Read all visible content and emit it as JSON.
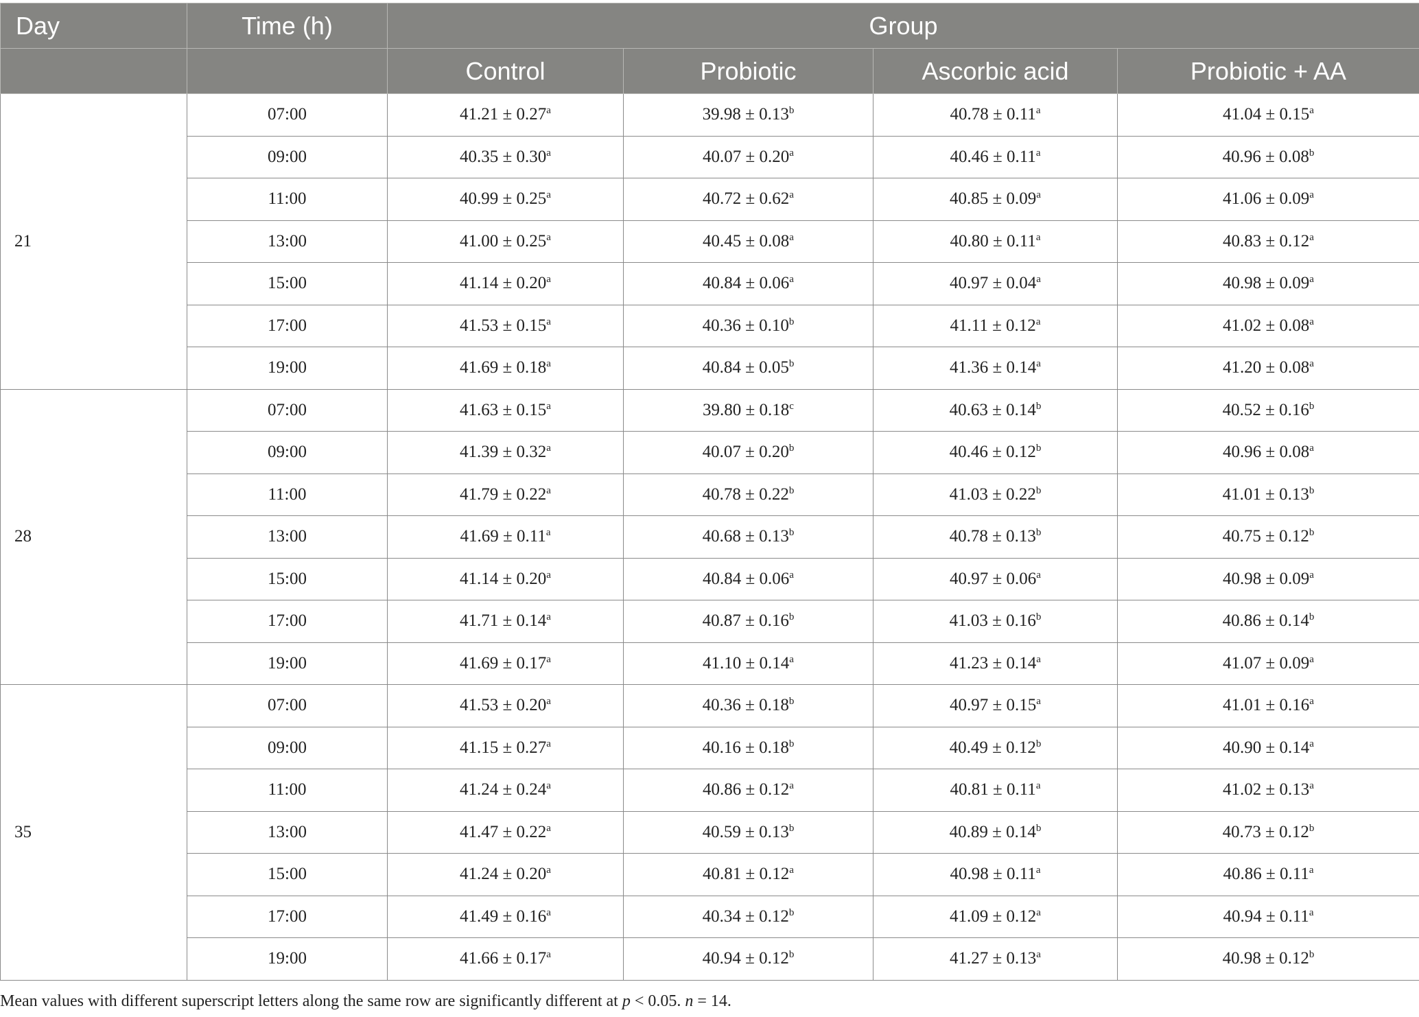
{
  "header": {
    "day": "Day",
    "time": "Time (h)",
    "group": "Group",
    "groups": [
      "Control",
      "Probiotic",
      "Ascorbic acid",
      "Probiotic + AA"
    ]
  },
  "blocks": [
    {
      "day": "21",
      "rows": [
        {
          "time": "07:00",
          "cells": [
            {
              "v": "41.21 ± 0.27",
              "s": "a"
            },
            {
              "v": "39.98 ± 0.13",
              "s": "b"
            },
            {
              "v": "40.78 ± 0.11",
              "s": "a"
            },
            {
              "v": "41.04 ± 0.15",
              "s": "a"
            }
          ]
        },
        {
          "time": "09:00",
          "cells": [
            {
              "v": "40.35 ± 0.30",
              "s": "a"
            },
            {
              "v": "40.07 ± 0.20",
              "s": "a"
            },
            {
              "v": "40.46 ± 0.11",
              "s": "a"
            },
            {
              "v": "40.96 ± 0.08",
              "s": "b"
            }
          ]
        },
        {
          "time": "11:00",
          "cells": [
            {
              "v": "40.99 ± 0.25",
              "s": "a"
            },
            {
              "v": "40.72 ± 0.62",
              "s": "a"
            },
            {
              "v": "40.85 ± 0.09",
              "s": "a"
            },
            {
              "v": "41.06 ± 0.09",
              "s": "a"
            }
          ]
        },
        {
          "time": "13:00",
          "cells": [
            {
              "v": "41.00 ± 0.25",
              "s": "a"
            },
            {
              "v": "40.45 ± 0.08",
              "s": "a"
            },
            {
              "v": "40.80 ± 0.11",
              "s": "a"
            },
            {
              "v": "40.83 ± 0.12",
              "s": "a"
            }
          ]
        },
        {
          "time": "15:00",
          "cells": [
            {
              "v": "41.14 ± 0.20",
              "s": "a"
            },
            {
              "v": "40.84 ± 0.06",
              "s": "a"
            },
            {
              "v": "40.97 ± 0.04",
              "s": "a"
            },
            {
              "v": "40.98 ± 0.09",
              "s": "a"
            }
          ]
        },
        {
          "time": "17:00",
          "cells": [
            {
              "v": "41.53 ± 0.15",
              "s": "a"
            },
            {
              "v": "40.36 ± 0.10",
              "s": "b"
            },
            {
              "v": "41.11 ± 0.12",
              "s": "a"
            },
            {
              "v": "41.02 ± 0.08",
              "s": "a"
            }
          ]
        },
        {
          "time": "19:00",
          "cells": [
            {
              "v": "41.69 ± 0.18",
              "s": "a"
            },
            {
              "v": "40.84 ± 0.05",
              "s": "b"
            },
            {
              "v": "41.36 ± 0.14",
              "s": "a"
            },
            {
              "v": "41.20 ± 0.08",
              "s": "a"
            }
          ]
        }
      ]
    },
    {
      "day": "28",
      "rows": [
        {
          "time": "07:00",
          "cells": [
            {
              "v": "41.63 ± 0.15",
              "s": "a"
            },
            {
              "v": "39.80 ± 0.18",
              "s": "c"
            },
            {
              "v": "40.63 ± 0.14",
              "s": "b"
            },
            {
              "v": "40.52 ± 0.16",
              "s": "b"
            }
          ]
        },
        {
          "time": "09:00",
          "cells": [
            {
              "v": "41.39 ± 0.32",
              "s": "a"
            },
            {
              "v": "40.07 ± 0.20",
              "s": "b"
            },
            {
              "v": "40.46 ± 0.12",
              "s": "b"
            },
            {
              "v": "40.96 ± 0.08",
              "s": "a"
            }
          ]
        },
        {
          "time": "11:00",
          "cells": [
            {
              "v": "41.79 ± 0.22",
              "s": "a"
            },
            {
              "v": "40.78 ± 0.22",
              "s": "b"
            },
            {
              "v": "41.03 ± 0.22",
              "s": "b"
            },
            {
              "v": "41.01 ± 0.13",
              "s": "b"
            }
          ]
        },
        {
          "time": "13:00",
          "cells": [
            {
              "v": "41.69 ± 0.11",
              "s": "a"
            },
            {
              "v": "40.68 ± 0.13",
              "s": "b"
            },
            {
              "v": "40.78 ± 0.13",
              "s": "b"
            },
            {
              "v": "40.75 ± 0.12",
              "s": "b"
            }
          ]
        },
        {
          "time": "15:00",
          "cells": [
            {
              "v": "41.14 ± 0.20",
              "s": "a"
            },
            {
              "v": "40.84 ± 0.06",
              "s": "a"
            },
            {
              "v": "40.97 ± 0.06",
              "s": "a"
            },
            {
              "v": "40.98 ± 0.09",
              "s": "a"
            }
          ]
        },
        {
          "time": "17:00",
          "cells": [
            {
              "v": "41.71 ± 0.14",
              "s": "a"
            },
            {
              "v": "40.87 ± 0.16",
              "s": "b"
            },
            {
              "v": "41.03 ± 0.16",
              "s": "b"
            },
            {
              "v": "40.86 ± 0.14",
              "s": "b"
            }
          ]
        },
        {
          "time": "19:00",
          "cells": [
            {
              "v": "41.69 ± 0.17",
              "s": "a"
            },
            {
              "v": "41.10 ± 0.14",
              "s": "a"
            },
            {
              "v": "41.23 ± 0.14",
              "s": "a"
            },
            {
              "v": "41.07 ± 0.09",
              "s": "a"
            }
          ]
        }
      ]
    },
    {
      "day": "35",
      "rows": [
        {
          "time": "07:00",
          "cells": [
            {
              "v": "41.53 ± 0.20",
              "s": "a"
            },
            {
              "v": "40.36 ± 0.18",
              "s": "b"
            },
            {
              "v": "40.97 ± 0.15",
              "s": "a"
            },
            {
              "v": "41.01 ± 0.16",
              "s": "a"
            }
          ]
        },
        {
          "time": "09:00",
          "cells": [
            {
              "v": "41.15 ± 0.27",
              "s": "a"
            },
            {
              "v": "40.16 ± 0.18",
              "s": "b"
            },
            {
              "v": "40.49 ± 0.12",
              "s": "b"
            },
            {
              "v": "40.90 ± 0.14",
              "s": "a"
            }
          ]
        },
        {
          "time": "11:00",
          "cells": [
            {
              "v": "41.24 ± 0.24",
              "s": "a"
            },
            {
              "v": "40.86 ± 0.12",
              "s": "a"
            },
            {
              "v": "40.81 ± 0.11",
              "s": "a"
            },
            {
              "v": "41.02 ± 0.13",
              "s": "a"
            }
          ]
        },
        {
          "time": "13:00",
          "cells": [
            {
              "v": "41.47 ± 0.22",
              "s": "a"
            },
            {
              "v": "40.59 ± 0.13",
              "s": "b"
            },
            {
              "v": "40.89 ± 0.14",
              "s": "b"
            },
            {
              "v": "40.73 ± 0.12",
              "s": "b"
            }
          ]
        },
        {
          "time": "15:00",
          "cells": [
            {
              "v": "41.24 ± 0.20",
              "s": "a"
            },
            {
              "v": "40.81 ± 0.12",
              "s": "a"
            },
            {
              "v": "40.98 ± 0.11",
              "s": "a"
            },
            {
              "v": "40.86 ± 0.11",
              "s": "a"
            }
          ]
        },
        {
          "time": "17:00",
          "cells": [
            {
              "v": "41.49 ± 0.16",
              "s": "a"
            },
            {
              "v": "40.34 ± 0.12",
              "s": "b"
            },
            {
              "v": "41.09 ± 0.12",
              "s": "a"
            },
            {
              "v": "40.94 ± 0.11",
              "s": "a"
            }
          ]
        },
        {
          "time": "19:00",
          "cells": [
            {
              "v": "41.66 ± 0.17",
              "s": "a"
            },
            {
              "v": "40.94 ± 0.12",
              "s": "b"
            },
            {
              "v": "41.27 ± 0.13",
              "s": "a"
            },
            {
              "v": "40.98 ± 0.12",
              "s": "b"
            }
          ]
        }
      ]
    }
  ],
  "footnote": {
    "text1": "Mean values with different superscript letters along the same row are significantly different at ",
    "p": "p",
    "text2": " < 0.05. ",
    "n": "n",
    "text3": " = 14."
  }
}
